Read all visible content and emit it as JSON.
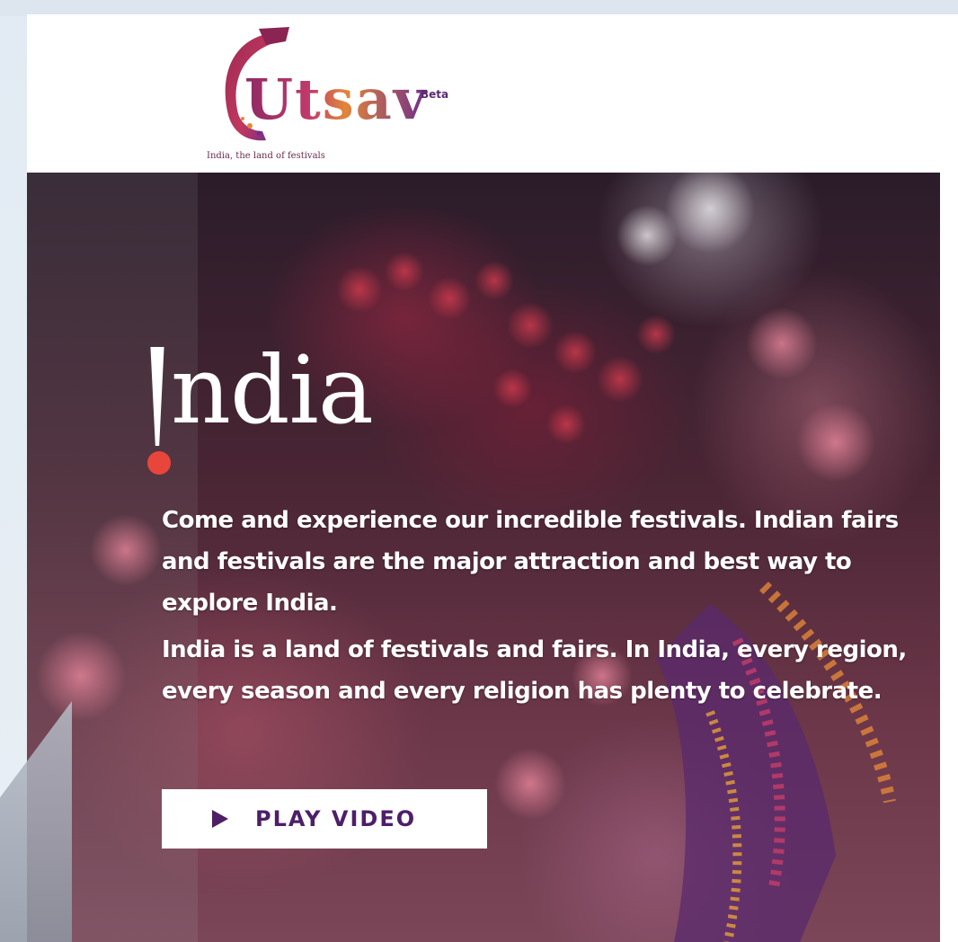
{
  "logo": {
    "wordmark": "Utsav",
    "badge": "Beta",
    "tagline": "India, the land of festivals"
  },
  "hero": {
    "wordmark": "ndia",
    "paragraphs": [
      "Come and experience our incredible festivals. Indian fairs and festivals are the major attraction and best way to explore India.",
      "India is a land of festivals and fairs. In India, every region, every season and every religion has plenty to celebrate."
    ],
    "play_button_label": "PLAY VIDEO"
  },
  "colors": {
    "brand_purple": "#4e1f67",
    "accent_red": "#e8463a",
    "hero_dark": "#2b1c2a"
  },
  "icons": {
    "play": "play-icon"
  }
}
